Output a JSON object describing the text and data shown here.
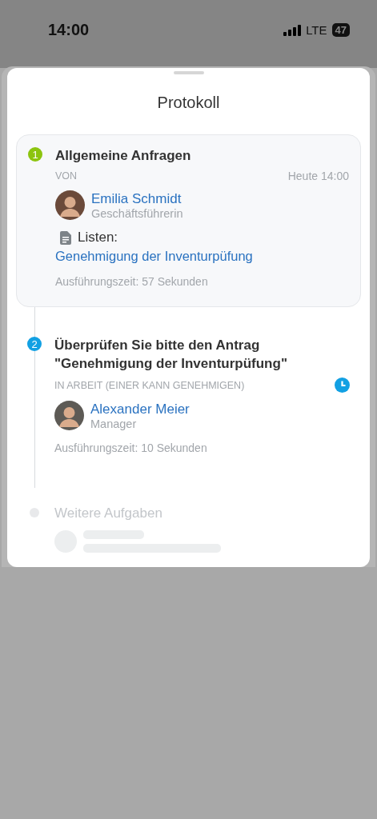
{
  "status_bar": {
    "time": "14:00",
    "network": "LTE",
    "battery": "47"
  },
  "sheet": {
    "title": "Protokoll"
  },
  "steps": [
    {
      "kind": "done",
      "number": "1",
      "title": "Allgemeine Anfragen",
      "status_label": "VON",
      "time": "Heute 14:00",
      "person": {
        "name": "Emilia Schmidt",
        "role": "Geschäftsführerin"
      },
      "attachment": {
        "label": "Listen:",
        "link": "Genehmigung der Inventurpüfung"
      },
      "duration": "Ausführungszeit: 57 Sekunden"
    },
    {
      "kind": "active",
      "number": "2",
      "title": "Überprüfen Sie bitte den Antrag \"Genehmigung der Inventurpüfung\"",
      "status_label": "IN ARBEIT (EINER KANN GENEHMIGEN)",
      "person": {
        "name": "Alexander Meier",
        "role": "Manager"
      },
      "duration": "Ausführungszeit: 10 Sekunden"
    },
    {
      "kind": "pending",
      "title": "Weitere Aufgaben"
    }
  ]
}
